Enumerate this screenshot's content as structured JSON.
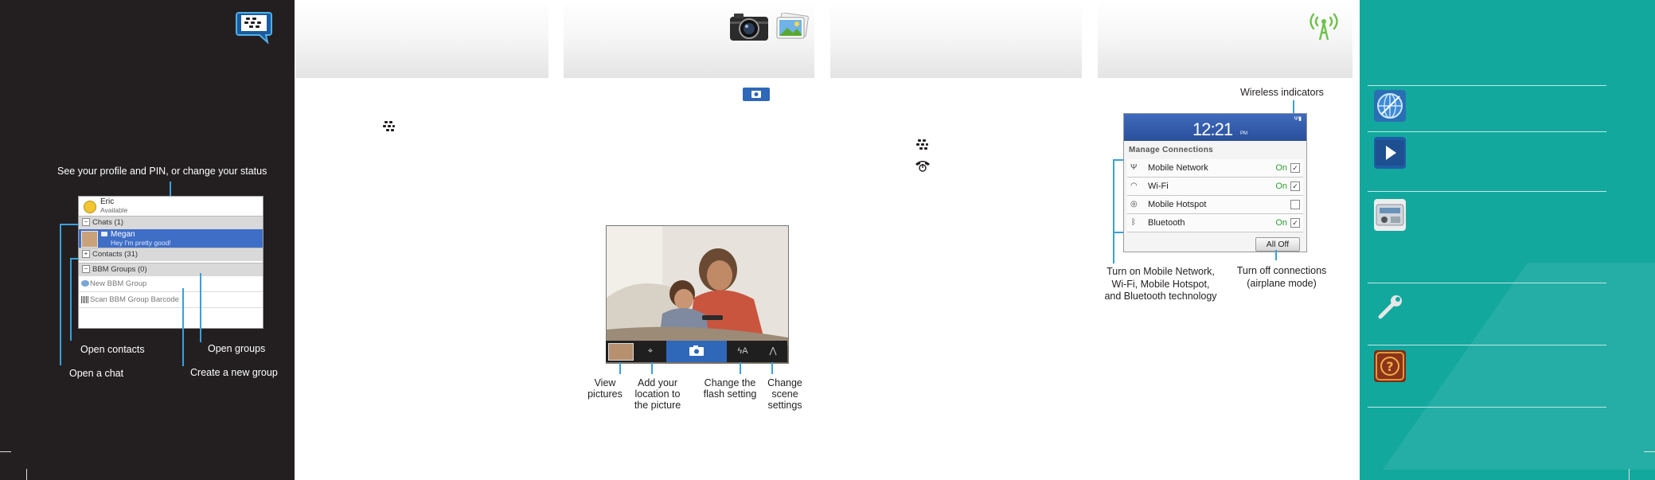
{
  "bbm": {
    "profile_callout": "See your profile and PIN, or change your  status",
    "profile_name": "Eric",
    "profile_status": "Available",
    "chats_header": "Chats (1)",
    "chat_name": "Megan",
    "chat_message": "Hey I'm pretty good!",
    "contacts_header": "Contacts (31)",
    "groups_header": "BBM Groups (0)",
    "new_group": "New BBM Group",
    "scan_group": "Scan BBM Group Barcode",
    "open_contacts": "Open contacts",
    "open_groups": "Open groups",
    "open_chat": "Open a chat",
    "create_group": "Create a new group"
  },
  "camera": {
    "view_pictures": "View\npictures",
    "add_location": "Add your\nlocation to\nthe picture",
    "change_flash": "Change the\nflash setting",
    "change_scene": "Change\nscene\nsettings"
  },
  "connections": {
    "wireless_indicators": "Wireless indicators",
    "time": "12:21",
    "ampm": "PM",
    "title": "Manage Connections",
    "rows": [
      {
        "label": "Mobile Network",
        "state": "On",
        "checked": true
      },
      {
        "label": "Wi-Fi",
        "state": "On",
        "checked": true
      },
      {
        "label": "Mobile Hotspot",
        "state": "",
        "checked": false
      },
      {
        "label": "Bluetooth",
        "state": "On",
        "checked": true
      }
    ],
    "all_off": "All Off",
    "turn_on_callout": "Turn on Mobile Network,\nWi-Fi, Mobile Hotspot,\nand Bluetooth technology",
    "turn_off_callout": "Turn off connections\n(airplane mode)"
  },
  "colors": {
    "black_panel": "#231f20",
    "teal_panel": "#13a89e",
    "callout_line": "#3aa0d8",
    "selection_blue": "#3f6ec7",
    "on_green": "#2f9e2f"
  },
  "icons": {
    "bbm": "bbm-logo-icon",
    "camera": "camera-icon",
    "pictures": "pictures-icon",
    "wireless": "wireless-antenna-icon",
    "browser": "browser-globe-icon",
    "media": "media-play-icon",
    "radio": "radio-icon",
    "options": "options-wrench-icon",
    "help": "help-icon"
  }
}
